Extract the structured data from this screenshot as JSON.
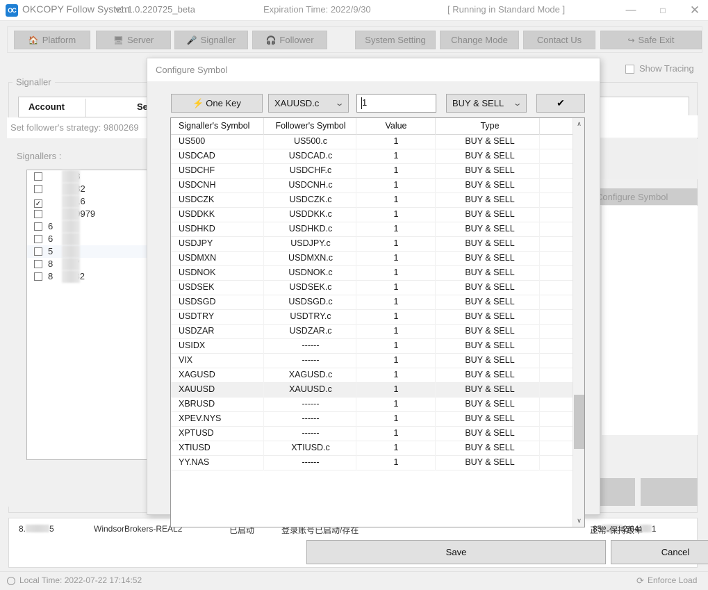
{
  "titlebar": {
    "logo_text": "OC",
    "app_title": "OKCOPY Follow System",
    "version": "v1.1.0.220725_beta",
    "expiration": "Expiration Time: 2022/9/30",
    "run_mode": "[ Running in Standard Mode ]",
    "minimize": "—",
    "maximize": "□",
    "close": "✕"
  },
  "toolbar": {
    "platform": "Platform",
    "platform_icon": "🏠",
    "server": "Server",
    "server_icon": "🖥",
    "signaller": "Signaller",
    "signaller_icon": "🎤",
    "follower": "Follower",
    "follower_icon": "🎧",
    "system_setting": "System Setting",
    "change_mode": "Change Mode",
    "contact_us": "Contact Us",
    "safe_exit": "Safe Exit",
    "safe_exit_icon": "↪"
  },
  "background": {
    "signaller_legend": "Signaller",
    "account_header": "Account",
    "server_header": "Server",
    "strategy_text": "Set follower's strategy: 9800269",
    "signallers_label": "Signallers :",
    "configure_symbol_ghost": "Configure Symbol",
    "show_tracing_label": "Show Tracing",
    "signallers": [
      {
        "checked": false,
        "suffix": "28"
      },
      {
        "checked": false,
        "suffix": "382"
      },
      {
        "checked": true,
        "suffix": "616"
      },
      {
        "checked": false,
        "suffix": "79979"
      },
      {
        "checked": false,
        "suffix": "4",
        "prefix": "6"
      },
      {
        "checked": false,
        "suffix": "1",
        "prefix": "6"
      },
      {
        "checked": false,
        "suffix": "8",
        "prefix": "5"
      },
      {
        "checked": false,
        "suffix": "17",
        "prefix": "8"
      },
      {
        "checked": false,
        "suffix": "282",
        "prefix": "8"
      }
    ],
    "status_row": {
      "account": "8.      5",
      "server": "WindsorBrokers-REAL2",
      "state": "已启动",
      "message": "登录账号已启动/存在",
      "numbers": "85      2/64   1",
      "note": "正常-保持跟单"
    }
  },
  "dialog": {
    "title": "Configure Symbol",
    "one_key_label": "One Key",
    "one_key_icon": "⚡",
    "symbol_select_value": "XAUUSD.c",
    "value_input": "1",
    "value_input_placeholder": "",
    "type_select_value": "BUY & SELL",
    "apply_icon": "✔",
    "caret_icon": "⌄",
    "save_label": "Save",
    "cancel_label": "Cancel",
    "scroll_up_icon": "∧",
    "scroll_down_icon": "∨",
    "table": {
      "columns": [
        "Signaller's Symbol",
        "Follower's Symbol",
        "Value",
        "Type"
      ],
      "rows": [
        {
          "signaller": "US500",
          "follower": "US500.c",
          "value": "1",
          "type": "BUY & SELL",
          "selected": false
        },
        {
          "signaller": "USDCAD",
          "follower": "USDCAD.c",
          "value": "1",
          "type": "BUY & SELL",
          "selected": false
        },
        {
          "signaller": "USDCHF",
          "follower": "USDCHF.c",
          "value": "1",
          "type": "BUY & SELL",
          "selected": false
        },
        {
          "signaller": "USDCNH",
          "follower": "USDCNH.c",
          "value": "1",
          "type": "BUY & SELL",
          "selected": false
        },
        {
          "signaller": "USDCZK",
          "follower": "USDCZK.c",
          "value": "1",
          "type": "BUY & SELL",
          "selected": false
        },
        {
          "signaller": "USDDKK",
          "follower": "USDDKK.c",
          "value": "1",
          "type": "BUY & SELL",
          "selected": false
        },
        {
          "signaller": "USDHKD",
          "follower": "USDHKD.c",
          "value": "1",
          "type": "BUY & SELL",
          "selected": false
        },
        {
          "signaller": "USDJPY",
          "follower": "USDJPY.c",
          "value": "1",
          "type": "BUY & SELL",
          "selected": false
        },
        {
          "signaller": "USDMXN",
          "follower": "USDMXN.c",
          "value": "1",
          "type": "BUY & SELL",
          "selected": false
        },
        {
          "signaller": "USDNOK",
          "follower": "USDNOK.c",
          "value": "1",
          "type": "BUY & SELL",
          "selected": false
        },
        {
          "signaller": "USDSEK",
          "follower": "USDSEK.c",
          "value": "1",
          "type": "BUY & SELL",
          "selected": false
        },
        {
          "signaller": "USDSGD",
          "follower": "USDSGD.c",
          "value": "1",
          "type": "BUY & SELL",
          "selected": false
        },
        {
          "signaller": "USDTRY",
          "follower": "USDTRY.c",
          "value": "1",
          "type": "BUY & SELL",
          "selected": false
        },
        {
          "signaller": "USDZAR",
          "follower": "USDZAR.c",
          "value": "1",
          "type": "BUY & SELL",
          "selected": false
        },
        {
          "signaller": "USIDX",
          "follower": "------",
          "value": "1",
          "type": "BUY & SELL",
          "selected": false
        },
        {
          "signaller": "VIX",
          "follower": "------",
          "value": "1",
          "type": "BUY & SELL",
          "selected": false
        },
        {
          "signaller": "XAGUSD",
          "follower": "XAGUSD.c",
          "value": "1",
          "type": "BUY & SELL",
          "selected": false
        },
        {
          "signaller": "XAUUSD",
          "follower": "XAUUSD.c",
          "value": "1",
          "type": "BUY & SELL",
          "selected": true
        },
        {
          "signaller": "XBRUSD",
          "follower": "------",
          "value": "1",
          "type": "BUY & SELL",
          "selected": false
        },
        {
          "signaller": "XPEV.NYS",
          "follower": "------",
          "value": "1",
          "type": "BUY & SELL",
          "selected": false
        },
        {
          "signaller": "XPTUSD",
          "follower": "------",
          "value": "1",
          "type": "BUY & SELL",
          "selected": false
        },
        {
          "signaller": "XTIUSD",
          "follower": "XTIUSD.c",
          "value": "1",
          "type": "BUY & SELL",
          "selected": false
        },
        {
          "signaller": "YY.NAS",
          "follower": "------",
          "value": "1",
          "type": "BUY & SELL",
          "selected": false
        }
      ]
    }
  },
  "statusbar": {
    "local_time": "Local Time: 2022-07-22 17:14:52",
    "refresh_icon": "⟳",
    "enforce_load": "Enforce Load"
  }
}
